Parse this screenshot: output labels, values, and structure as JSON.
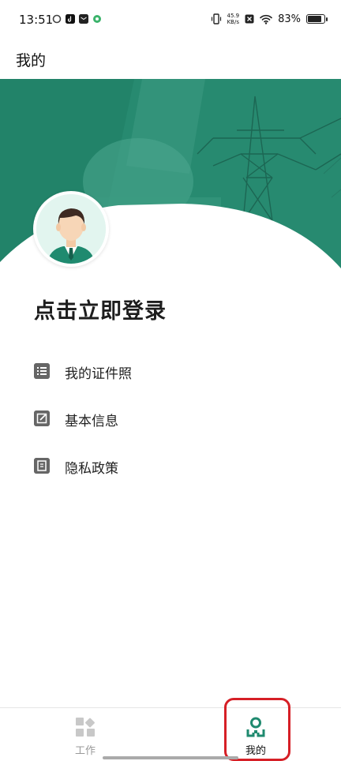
{
  "status_bar": {
    "time": "13:51",
    "net_speed_value": "45.9",
    "net_speed_unit": "KB/s",
    "battery_percent": "83%",
    "battery_level": 0.83
  },
  "header": {
    "title": "我的"
  },
  "profile": {
    "login_prompt": "点击立即登录"
  },
  "menu": {
    "items": [
      {
        "label": "我的证件照",
        "icon": "list-icon"
      },
      {
        "label": "基本信息",
        "icon": "edit-icon"
      },
      {
        "label": "隐私政策",
        "icon": "document-icon"
      }
    ]
  },
  "bottom_nav": {
    "items": [
      {
        "label": "工作",
        "icon": "grid-icon",
        "active": false
      },
      {
        "label": "我的",
        "icon": "person-icon",
        "active": true
      }
    ]
  },
  "colors": {
    "brand_green": "#1f8a6f",
    "highlight_red": "#d61f26"
  }
}
